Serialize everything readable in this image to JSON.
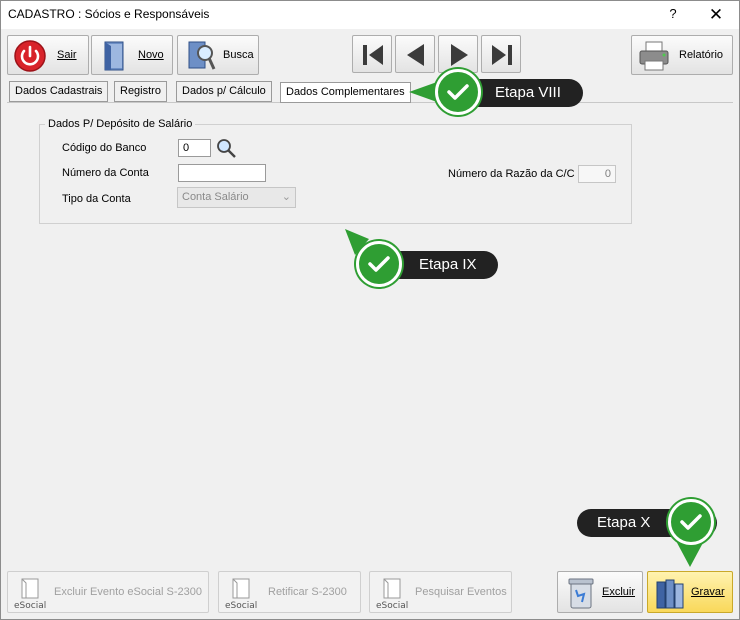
{
  "window": {
    "title": "CADASTRO : Sócios e Responsáveis",
    "help": "?",
    "close": "✕"
  },
  "toolbar": {
    "sair": "Sair",
    "novo": "Novo",
    "busca": "Busca",
    "relatorio": "Relatório"
  },
  "tabs": [
    {
      "label": "Dados Cadastrais"
    },
    {
      "label": "Registro"
    },
    {
      "label": "Dados p/ Cálculo"
    },
    {
      "label": "Dados Complementares"
    }
  ],
  "form": {
    "group_title": "Dados P/ Depósito de Salário",
    "codigo_banco_label": "Código do Banco",
    "codigo_banco_value": "0",
    "numero_conta_label": "Número da Conta",
    "numero_conta_value": "",
    "tipo_conta_label": "Tipo da Conta",
    "tipo_conta_value": "Conta Salário",
    "razao_label": "Número da Razão da C/C",
    "razao_value": "0"
  },
  "footer": {
    "excluir_evento": "Excluir Evento eSocial S-2300",
    "retificar": "Retificar S-2300",
    "pesquisar": "Pesquisar Eventos",
    "excluir": "Excluir",
    "gravar": "Gravar",
    "esocial_logo": "eSocial"
  },
  "callouts": {
    "viii": "Etapa VIII",
    "ix": "Etapa IX",
    "x": "Etapa X"
  },
  "colors": {
    "callout_bg": "#222222",
    "check_green": "#2f9e33"
  }
}
